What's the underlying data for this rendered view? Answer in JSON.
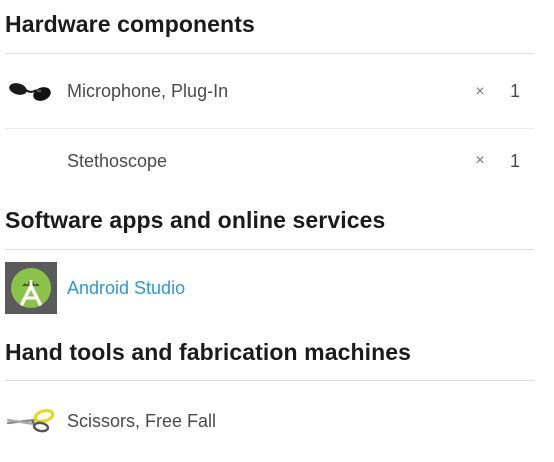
{
  "sections": {
    "hardware": {
      "heading": "Hardware components",
      "items": [
        {
          "name": "Microphone, Plug-In",
          "times": "×",
          "qty": "1",
          "icon": "microphone-icon"
        },
        {
          "name": "Stethoscope",
          "times": "×",
          "qty": "1",
          "icon": ""
        }
      ]
    },
    "software": {
      "heading": "Software apps and online services",
      "items": [
        {
          "name": "Android Studio",
          "icon": "android-studio-icon"
        }
      ]
    },
    "tools": {
      "heading": "Hand tools and fabrication machines",
      "items": [
        {
          "name": "Scissors, Free Fall",
          "icon": "scissors-icon"
        }
      ]
    }
  },
  "colors": {
    "link": "#2e97d4",
    "android_green": "#8bc34a",
    "scissors_yellow": "#e3d81b"
  }
}
